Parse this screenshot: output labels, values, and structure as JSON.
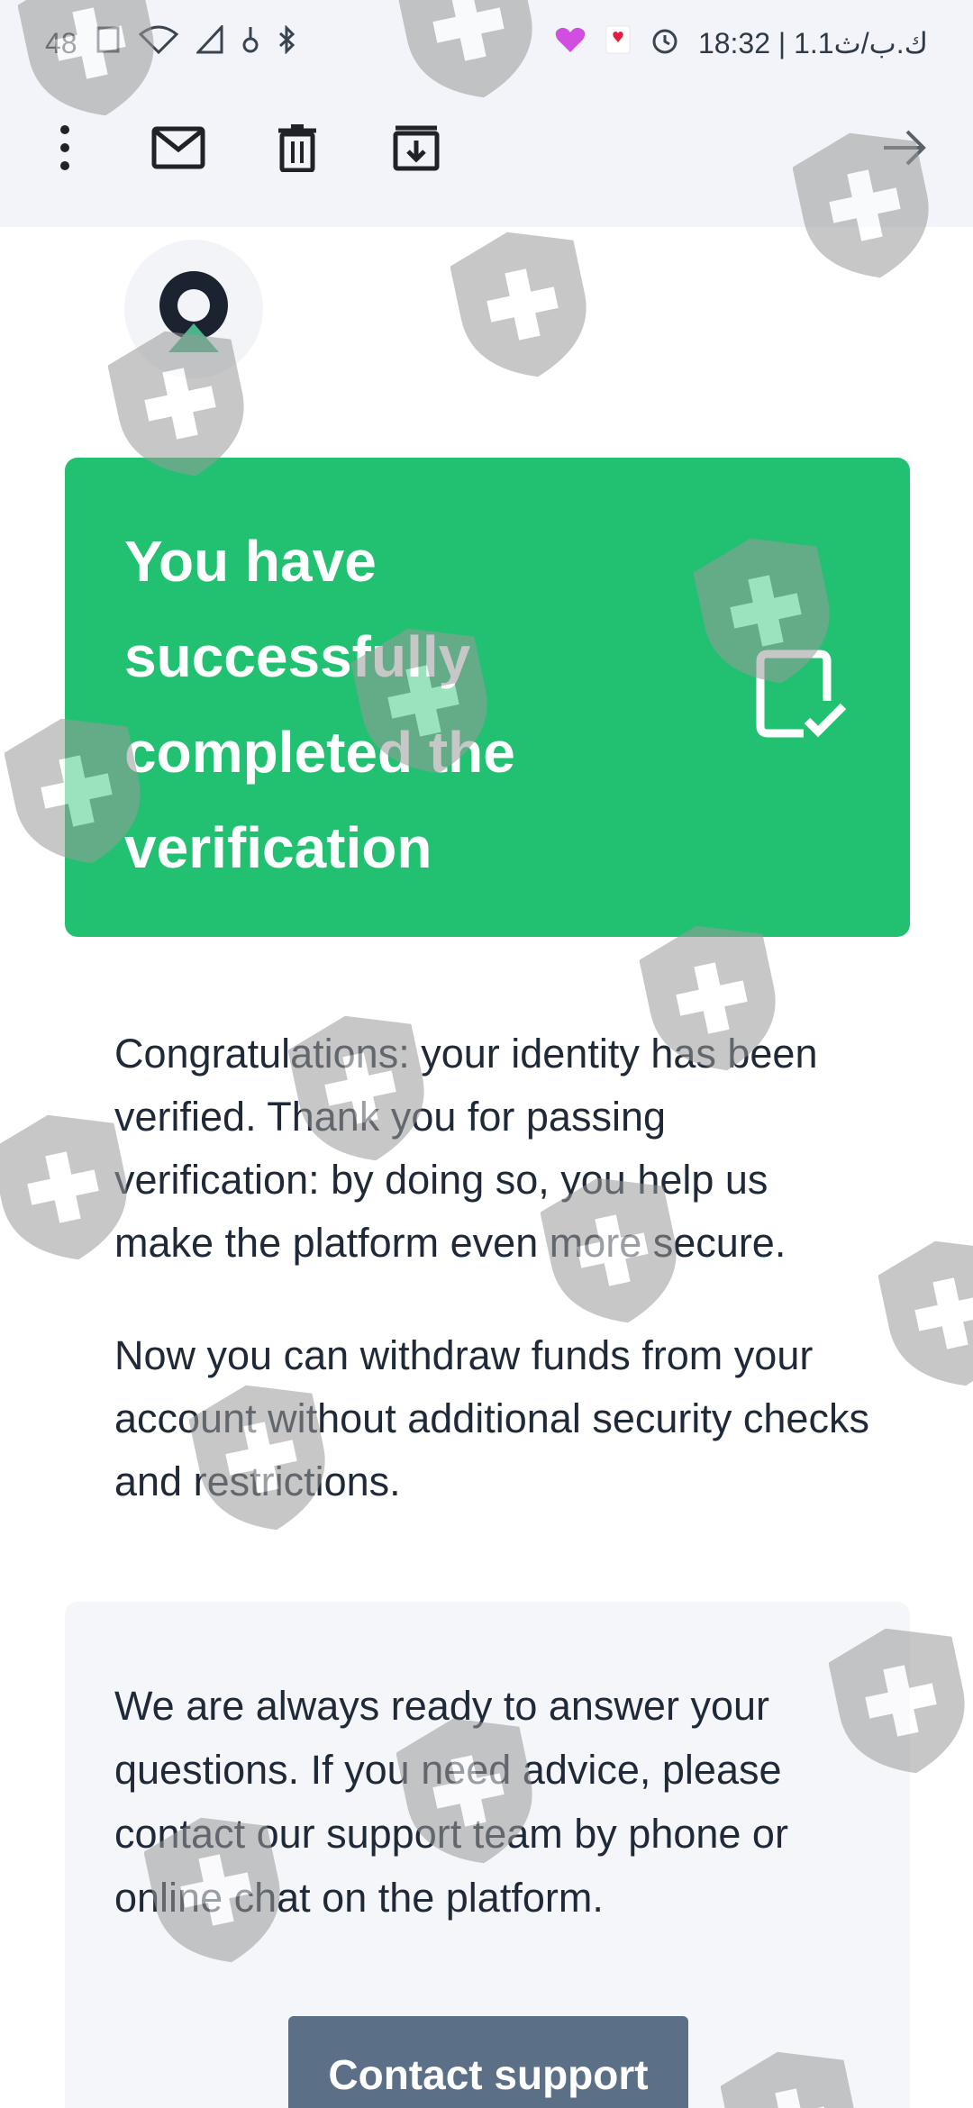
{
  "status_bar": {
    "left_indicator": "48",
    "right_text": "18:32 | 1.1ك.ب/ث"
  },
  "toolbar": {
    "icons": [
      "more-vertical-icon",
      "mail-icon",
      "trash-icon",
      "archive-icon",
      "arrow-right-icon"
    ]
  },
  "banner": {
    "title": "You have successfully completed the verification",
    "background": "#22c172",
    "icon": "checked-document-icon"
  },
  "content": {
    "paragraph_1": "Congratulations: your identity has been verified. Thank you for passing verification: by doing so, you help us make the platform even more secure.",
    "paragraph_2": "Now you can withdraw funds from your account without additional security checks and restrictions."
  },
  "support": {
    "text": "We are always ready to answer your questions. If you need advice, please contact our support team by phone or online chat on the platform.",
    "button_label": "Contact support",
    "button_color": "#5b6f86"
  },
  "colors": {
    "toolbar_bg": "#f3f4f9",
    "text": "#1f2937",
    "accent_green": "#22c172"
  }
}
